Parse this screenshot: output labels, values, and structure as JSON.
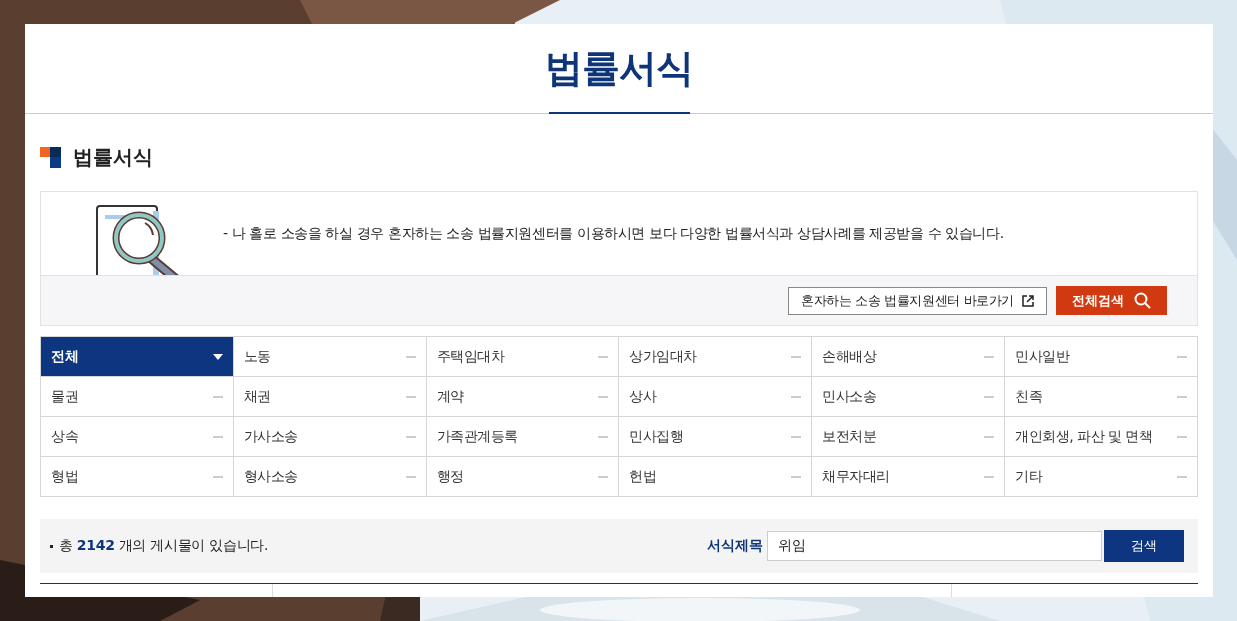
{
  "page_title": "법률서식",
  "section_title": "법률서식",
  "notice": {
    "text": "- 나 홀로 소송을 하실 경우 혼자하는 소송 법률지원센터를 이용하시면 보다 다양한 법률서식과 상담사례를 제공받을 수 있습니다.",
    "link_button": "혼자하는 소송 법률지원센터 바로가기",
    "search_all_button": "전체검색"
  },
  "categories": [
    {
      "label": "전체",
      "selected": true
    },
    {
      "label": "노동",
      "selected": false
    },
    {
      "label": "주택임대차",
      "selected": false
    },
    {
      "label": "상가임대차",
      "selected": false
    },
    {
      "label": "손해배상",
      "selected": false
    },
    {
      "label": "민사일반",
      "selected": false
    },
    {
      "label": "물권",
      "selected": false
    },
    {
      "label": "채권",
      "selected": false
    },
    {
      "label": "계약",
      "selected": false
    },
    {
      "label": "상사",
      "selected": false
    },
    {
      "label": "민사소송",
      "selected": false
    },
    {
      "label": "친족",
      "selected": false
    },
    {
      "label": "상속",
      "selected": false
    },
    {
      "label": "가사소송",
      "selected": false
    },
    {
      "label": "가족관계등록",
      "selected": false
    },
    {
      "label": "민사집행",
      "selected": false
    },
    {
      "label": "보전처분",
      "selected": false
    },
    {
      "label": "개인회생, 파산 및 면책",
      "selected": false
    },
    {
      "label": "형법",
      "selected": false
    },
    {
      "label": "형사소송",
      "selected": false
    },
    {
      "label": "행정",
      "selected": false
    },
    {
      "label": "헌법",
      "selected": false
    },
    {
      "label": "채무자대리",
      "selected": false
    },
    {
      "label": "기타",
      "selected": false
    }
  ],
  "summary": "총 **2142** 개의 게시물이 있습니다.",
  "search": {
    "label": "서식제목",
    "value": "위임",
    "button": "검색"
  }
}
